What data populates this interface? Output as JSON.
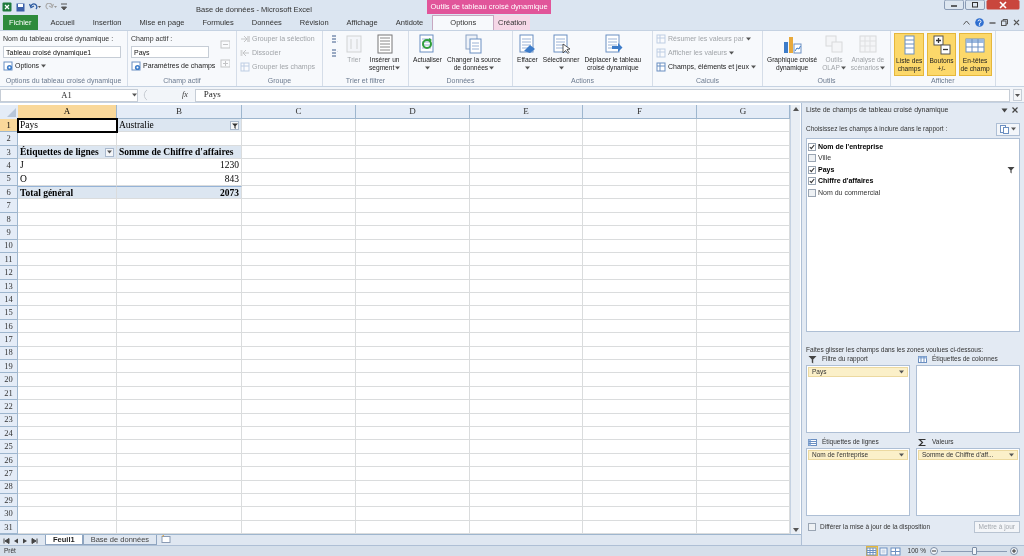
{
  "title_bar": {
    "title": "Base de données - Microsoft Excel",
    "context_tab": "Outils de tableau croisé dynamique"
  },
  "tabs": [
    {
      "label": "Fichier",
      "kind": "file",
      "selected": false
    },
    {
      "label": "Accueil",
      "kind": "normal",
      "selected": false
    },
    {
      "label": "Insertion",
      "kind": "normal",
      "selected": false
    },
    {
      "label": "Mise en page",
      "kind": "normal",
      "selected": false
    },
    {
      "label": "Formules",
      "kind": "normal",
      "selected": false
    },
    {
      "label": "Données",
      "kind": "normal",
      "selected": false
    },
    {
      "label": "Révision",
      "kind": "normal",
      "selected": false
    },
    {
      "label": "Affichage",
      "kind": "normal",
      "selected": false
    },
    {
      "label": "Antidote",
      "kind": "normal",
      "selected": false
    },
    {
      "label": "Options",
      "kind": "context",
      "selected": true
    },
    {
      "label": "Création",
      "kind": "context",
      "selected": false
    }
  ],
  "ribbon": {
    "groups": [
      {
        "label": "Options du tableau croisé dynamique",
        "columns": [
          [
            {
              "kind": "caption",
              "text": "Nom du tableau croisé dynamique :"
            },
            {
              "kind": "field",
              "value": "Tableau croisé dynamique1"
            },
            {
              "kind": "small",
              "label": "Options",
              "dropdown": true,
              "disabled": false
            }
          ]
        ]
      },
      {
        "label": "Champ actif",
        "columns": [
          [
            {
              "kind": "caption",
              "text": "Champ actif :"
            },
            {
              "kind": "field",
              "value": "Pays"
            },
            {
              "kind": "small",
              "label": "Paramètres de champs",
              "disabled": false
            }
          ],
          [
            {
              "kind": "icon",
              "disabled": true
            },
            {
              "kind": "icon",
              "disabled": true
            }
          ]
        ]
      },
      {
        "label": "Groupe",
        "columns": [
          [
            {
              "kind": "small",
              "label": "Grouper la sélection",
              "disabled": true
            },
            {
              "kind": "small",
              "label": "Dissocier",
              "disabled": true
            },
            {
              "kind": "small",
              "label": "Grouper les champs",
              "disabled": true
            }
          ]
        ]
      },
      {
        "label": "Trier et filtrer",
        "columns": [
          [
            {
              "kind": "icon",
              "disabled": false
            },
            {
              "kind": "icon",
              "disabled": false
            }
          ],
          [
            {
              "kind": "large",
              "lines": [
                "Trier"
              ],
              "disabled": true
            }
          ],
          [
            {
              "kind": "large",
              "lines": [
                "Insérer un",
                "segment"
              ],
              "dropdown": true,
              "disabled": false
            }
          ]
        ]
      },
      {
        "label": "Données",
        "columns": [
          [
            {
              "kind": "large",
              "lines": [
                "Actualiser"
              ],
              "dropdown": true,
              "disabled": false
            }
          ],
          [
            {
              "kind": "large",
              "lines": [
                "Changer la source",
                "de données"
              ],
              "dropdown": true,
              "disabled": false
            }
          ]
        ]
      },
      {
        "label": "Actions",
        "columns": [
          [
            {
              "kind": "large",
              "lines": [
                "Effacer"
              ],
              "dropdown": true,
              "disabled": false
            }
          ],
          [
            {
              "kind": "large",
              "lines": [
                "Sélectionner"
              ],
              "dropdown": true,
              "disabled": false
            }
          ],
          [
            {
              "kind": "large",
              "lines": [
                "Déplacer le tableau",
                "croisé dynamique"
              ],
              "disabled": false
            }
          ]
        ]
      },
      {
        "label": "Calculs",
        "columns": [
          [
            {
              "kind": "small",
              "label": "Résumer les valeurs par",
              "dropdown": true,
              "disabled": true
            },
            {
              "kind": "small",
              "label": "Afficher les valeurs",
              "dropdown": true,
              "disabled": true
            },
            {
              "kind": "small",
              "label": "Champs, éléments et jeux",
              "dropdown": true,
              "disabled": false
            }
          ]
        ]
      },
      {
        "label": "Outils",
        "columns": [
          [
            {
              "kind": "large",
              "lines": [
                "Graphique croisé",
                "dynamique"
              ],
              "disabled": false
            }
          ],
          [
            {
              "kind": "large",
              "lines": [
                "Outils",
                "OLAP"
              ],
              "dropdown": true,
              "disabled": true
            }
          ],
          [
            {
              "kind": "large",
              "lines": [
                "Analyse de",
                "scénarios"
              ],
              "dropdown": true,
              "disabled": true
            }
          ]
        ]
      },
      {
        "label": "Afficher",
        "columns": [
          [
            {
              "kind": "large",
              "lines": [
                "Liste des",
                "champs"
              ],
              "on": true
            }
          ],
          [
            {
              "kind": "large",
              "lines": [
                "Boutons",
                "+/-"
              ],
              "on": true
            }
          ],
          [
            {
              "kind": "large",
              "lines": [
                "En-têtes",
                "de champ"
              ],
              "on": true
            }
          ]
        ]
      }
    ]
  },
  "formula_bar": {
    "name_box": "A1",
    "function_label": "fx",
    "formula": "Pays"
  },
  "sheet": {
    "columns": [
      {
        "label": "A",
        "selected": true
      },
      {
        "label": "B",
        "selected": false
      },
      {
        "label": "C",
        "selected": false
      },
      {
        "label": "D",
        "selected": false
      },
      {
        "label": "E",
        "selected": false
      },
      {
        "label": "F",
        "selected": false
      },
      {
        "label": "G",
        "selected": false
      }
    ],
    "rows": [
      {
        "number": "1",
        "selected": true,
        "kind": "filter",
        "cells": [
          {
            "text": "Pays",
            "selected": true
          },
          {
            "text": "Australie",
            "selected": false,
            "kind": "filter"
          }
        ]
      },
      {
        "number": "2",
        "selected": false
      },
      {
        "number": "3",
        "selected": false,
        "kind": "header",
        "cells": [
          {
            "text": "Étiquettes de lignes",
            "selected": false,
            "kind": "dropdown"
          },
          {
            "text": "Somme de Chiffre d'affaires",
            "selected": false
          }
        ]
      },
      {
        "number": "4",
        "selected": false,
        "kind": "item",
        "cells": [
          {
            "text": "J",
            "selected": false
          },
          {
            "text": "1230",
            "selected": false
          }
        ]
      },
      {
        "number": "5",
        "selected": false,
        "kind": "item",
        "cells": [
          {
            "text": "O",
            "selected": false
          },
          {
            "text": "843",
            "selected": false
          }
        ]
      },
      {
        "number": "6",
        "selected": false,
        "kind": "total",
        "cells": [
          {
            "text": "Total général",
            "selected": false
          },
          {
            "text": "2073",
            "selected": false
          }
        ]
      },
      {
        "number": "7",
        "selected": false
      },
      {
        "number": "8",
        "selected": false
      },
      {
        "number": "9",
        "selected": false
      },
      {
        "number": "10",
        "selected": false
      },
      {
        "number": "11",
        "selected": false
      },
      {
        "number": "12",
        "selected": false
      },
      {
        "number": "13",
        "selected": false
      },
      {
        "number": "14",
        "selected": false
      },
      {
        "number": "15",
        "selected": false
      },
      {
        "number": "16",
        "selected": false
      },
      {
        "number": "17",
        "selected": false
      },
      {
        "number": "18",
        "selected": false
      },
      {
        "number": "19",
        "selected": false
      },
      {
        "number": "20",
        "selected": false
      },
      {
        "number": "21",
        "selected": false
      },
      {
        "number": "22",
        "selected": false
      },
      {
        "number": "23",
        "selected": false
      },
      {
        "number": "24",
        "selected": false
      },
      {
        "number": "25",
        "selected": false
      },
      {
        "number": "26",
        "selected": false
      },
      {
        "number": "27",
        "selected": false
      },
      {
        "number": "28",
        "selected": false
      },
      {
        "number": "29",
        "selected": false
      },
      {
        "number": "30",
        "selected": false
      },
      {
        "number": "31",
        "selected": false
      }
    ]
  },
  "sheet_tabs": [
    {
      "label": "Feuil1",
      "selected": true
    },
    {
      "label": "Base de données",
      "selected": false
    }
  ],
  "field_list": {
    "title": "Liste de champs de tableau croisé dynamique",
    "choose_label": "Choisissez les champs à inclure dans le rapport :",
    "fields": [
      {
        "name": "Nom de l'entreprise",
        "checked": true,
        "filtered": false
      },
      {
        "name": "Ville",
        "checked": false,
        "filtered": false
      },
      {
        "name": "Pays",
        "checked": true,
        "filtered": true
      },
      {
        "name": "Chiffre d'affaires",
        "checked": true,
        "filtered": false
      },
      {
        "name": "Nom du commercial",
        "checked": false,
        "filtered": false
      }
    ],
    "drag_label": "Faites glisser les champs dans les zones voulues ci-dessous:",
    "zones": [
      {
        "kind": "filter",
        "title": "Filtre du rapport",
        "items": [
          "Pays"
        ]
      },
      {
        "kind": "columns",
        "title": "Étiquettes de colonnes"
      },
      {
        "kind": "rows",
        "title": "Étiquettes de lignes",
        "items": [
          "Nom de l'entreprise"
        ]
      },
      {
        "kind": "values",
        "title": "Valeurs",
        "items": [
          "Somme de Chiffre d'aff..."
        ]
      }
    ],
    "defer": {
      "label": "Différer la mise à jour de la disposition",
      "checked": false
    },
    "update_button": {
      "label": "Mettre à jour",
      "disabled": true
    }
  },
  "status_bar": {
    "ready": "Prêt",
    "views": [
      {
        "selected": true
      },
      {
        "selected": false
      },
      {
        "selected": false
      }
    ],
    "zoom": "100 %",
    "zoom_slider": {
      "level": 0.5
    }
  }
}
